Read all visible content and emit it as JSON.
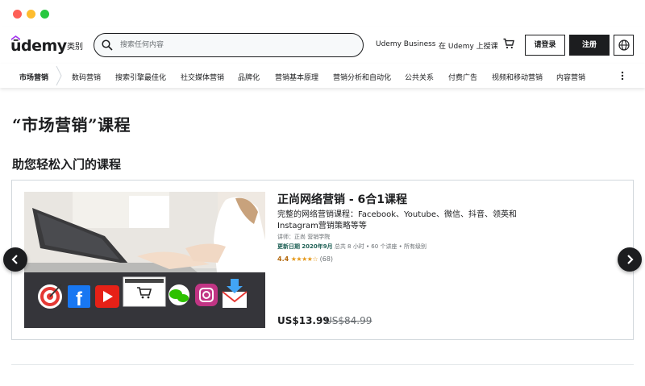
{
  "header": {
    "logo_text": "ūdemy",
    "categories_label": "类别",
    "search_placeholder": "搜索任何内容",
    "business_link": "Udemy Business",
    "teach_link": "在 Udemy 上授课",
    "login_label": "请登录",
    "signup_label": "注册",
    "brand_color": "#a435f0"
  },
  "subnav": {
    "current": "市场营销",
    "items": [
      "数码营销",
      "搜索引擎最佳化",
      "社交媒体营销",
      "品牌化",
      "营销基本原理",
      "营销分析和自动化",
      "公共关系",
      "付费广告",
      "视频和移动营销",
      "内容营销"
    ]
  },
  "page": {
    "title": "“市场营销”课程",
    "section_title": "助您轻松入门的课程"
  },
  "course": {
    "title": "正尚网络营销 - 6合1课程",
    "description": "完整的网络营销课程：Facebook、Youtube、微信、抖音、领英和Instagram营销策略等等",
    "instructor": "讲师：正尚 营销学院",
    "updated_label": "更新日期",
    "updated_date": "2020年9月",
    "details": "总共 8 小时 • 60 个讲座 • 所有级别",
    "rating": "4.4",
    "stars": "★★★★☆",
    "rating_count": "(68)",
    "price": "US$13.99",
    "original_price": "US$84.99"
  },
  "icons": {
    "search": "search-icon",
    "cart": "cart-icon",
    "language": "globe-icon",
    "more": "more-vertical-icon",
    "prev": "chevron-left-icon",
    "next": "chevron-right-icon"
  }
}
